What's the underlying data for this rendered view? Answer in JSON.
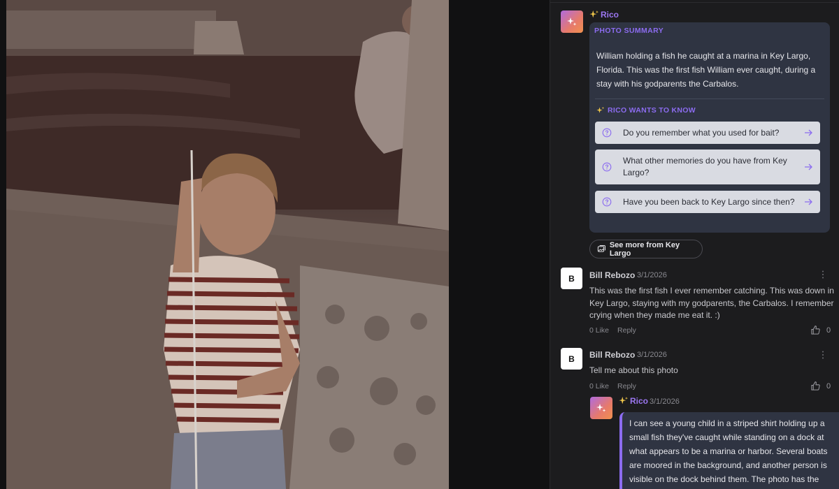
{
  "rico": {
    "name": "Rico",
    "summary_heading": "PHOTO SUMMARY",
    "summary_text": "William holding a fish he caught at a marina in Key Largo, Florida. This was the first fish William ever caught, during a stay with his godparents the Carbalos.",
    "wants_heading": "RICO WANTS TO KNOW",
    "questions": [
      "Do you remember what you used for bait?",
      "What other memories do you have from Key Largo?",
      "Have you been back to Key Largo since then?"
    ],
    "see_more_label": "See more from Key Largo"
  },
  "comments": [
    {
      "avatar_letter": "B",
      "author": "Bill Rebozo",
      "date": "3/1/2026",
      "text": "This was the first fish I ever remember catching. This was down in Key Largo, staying with my godparents, the Carbalos. I remember crying when they made me eat it. :)",
      "like_label": "0 Like",
      "reply_label": "Reply",
      "like_count": "0"
    },
    {
      "avatar_letter": "B",
      "author": "Bill Rebozo",
      "date": "3/1/2026",
      "text": "Tell me about this photo",
      "like_label": "0 Like",
      "reply_label": "Reply",
      "like_count": "0"
    }
  ],
  "rico_reply": {
    "name": "Rico",
    "date": "3/1/2026",
    "text": "I can see a young child in a striped shirt holding up a small fish they've caught while standing on a dock at what appears to be a marina or harbor. Several boats are moored in the background, and another person is visible on the dock behind them. The photo has the warm, faded tones of the"
  },
  "icons": {
    "sparkle": "sparkle-icon",
    "question": "question-circle-icon",
    "arrow": "arrow-right-icon",
    "photos": "photos-icon",
    "more": "more-vertical-icon",
    "like": "thumbs-up-icon"
  },
  "colors": {
    "accent": "#8c6cf0",
    "card_bg": "#2f3442",
    "question_bg": "#d9dbe2",
    "sparkle_gold": "#f2c84b"
  }
}
